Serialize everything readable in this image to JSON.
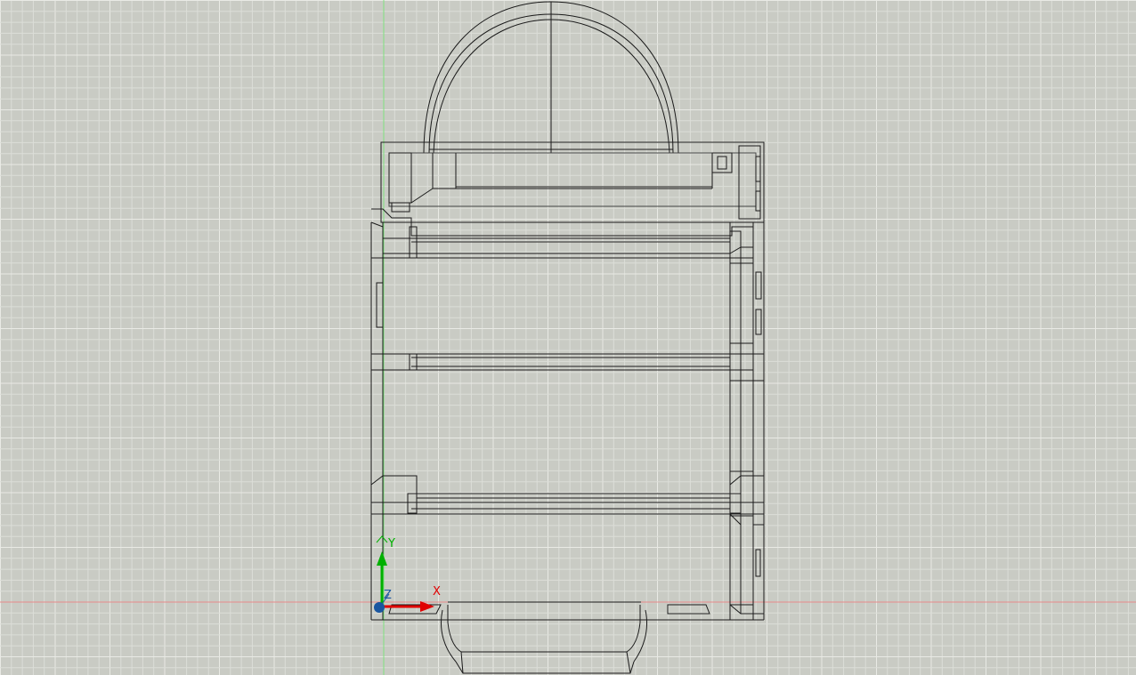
{
  "canvas": {
    "background_color": "#c9cbc4",
    "grid_color": "#dcded8",
    "grid_major_color": "#e9eae5",
    "x_axis_color": "#e88a8a",
    "y_axis_color": "#7ee07e",
    "wire_color": "#1a1a1a",
    "wire_light_color": "#4a4a4a"
  },
  "ucs": {
    "x_label": "X",
    "y_label": "Y",
    "z_label": "Z",
    "x_color": "#e00000",
    "y_color": "#00b000",
    "z_color": "#1a56a0"
  }
}
